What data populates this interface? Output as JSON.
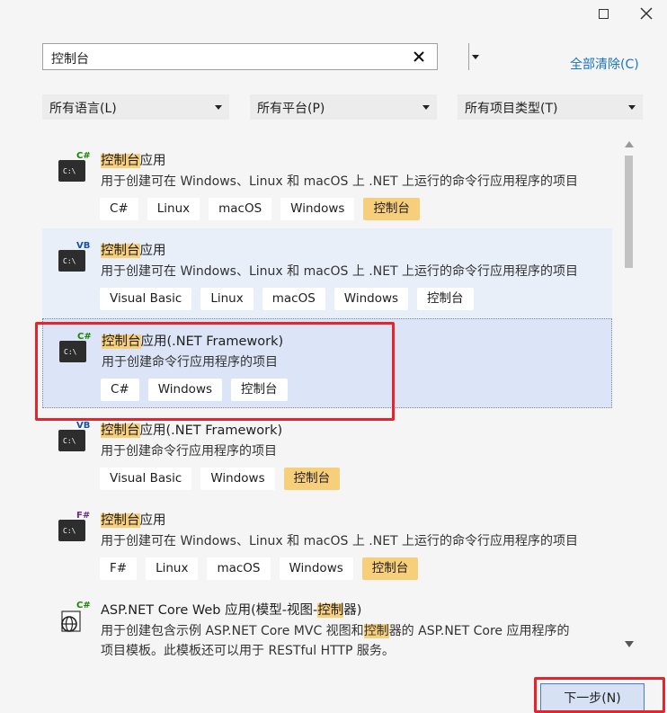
{
  "window": {
    "maximize_icon": "maximize-icon",
    "close_icon": "close-icon"
  },
  "search": {
    "value": "控制台",
    "clear_icon": "x-icon",
    "dropdown_icon": "chevron-down-icon"
  },
  "clear_all_label": "全部清除(C)",
  "filters": {
    "language": "所有语言(L)",
    "platform": "所有平台(P)",
    "project_type": "所有项目类型(T)"
  },
  "templates": [
    {
      "title_hl": "控制台",
      "title_rest": "应用",
      "lang_badge": "C#",
      "lang_color": "#178600",
      "desc": "用于创建可在 Windows、Linux 和 macOS 上 .NET 上运行的命令行应用程序的项目",
      "tags": [
        "C#",
        "Linux",
        "macOS",
        "Windows"
      ],
      "tag_hl": "控制台"
    },
    {
      "title_hl": "控制台",
      "title_rest": "应用",
      "lang_badge": "VB",
      "lang_color": "#1a4fa8",
      "desc": "用于创建可在 Windows、Linux 和 macOS 上 .NET 上运行的命令行应用程序的项目",
      "tags": [
        "Visual Basic",
        "Linux",
        "macOS",
        "Windows"
      ],
      "tag_hl": "控制台"
    },
    {
      "title_hl": "控制台",
      "title_rest": "应用(.NET Framework)",
      "lang_badge": "C#",
      "lang_color": "#178600",
      "desc": "用于创建命令行应用程序的项目",
      "tags": [
        "C#",
        "Windows"
      ],
      "tag_hl": "控制台"
    },
    {
      "title_hl": "控制台",
      "title_rest": "应用(.NET Framework)",
      "lang_badge": "VB",
      "lang_color": "#1a4fa8",
      "desc": "用于创建命令行应用程序的项目",
      "tags": [
        "Visual Basic",
        "Windows"
      ],
      "tag_hl": "控制台"
    },
    {
      "title_hl": "控制台",
      "title_rest": "应用",
      "lang_badge": "F#",
      "lang_color": "#6a2c91",
      "desc": "用于创建可在 Windows、Linux 和 macOS 上 .NET 上运行的命令行应用程序的项目",
      "tags": [
        "F#",
        "Linux",
        "macOS",
        "Windows"
      ],
      "tag_hl": "控制台"
    },
    {
      "title_a": "ASP.NET Core Web 应用(模型-视图-",
      "title_hl": "控制",
      "title_b": "器)",
      "lang_badge": "C#",
      "lang_color": "#178600",
      "desc_a": "用于创建包含示例 ASP.NET Core MVC 视图和",
      "desc_hl": "控制",
      "desc_b": "器的 ASP.NET Core 应用程序的",
      "desc2": "项目模板。此模板还可以用于 RESTful HTTP 服务。"
    }
  ],
  "next_button": "下一步(N)"
}
